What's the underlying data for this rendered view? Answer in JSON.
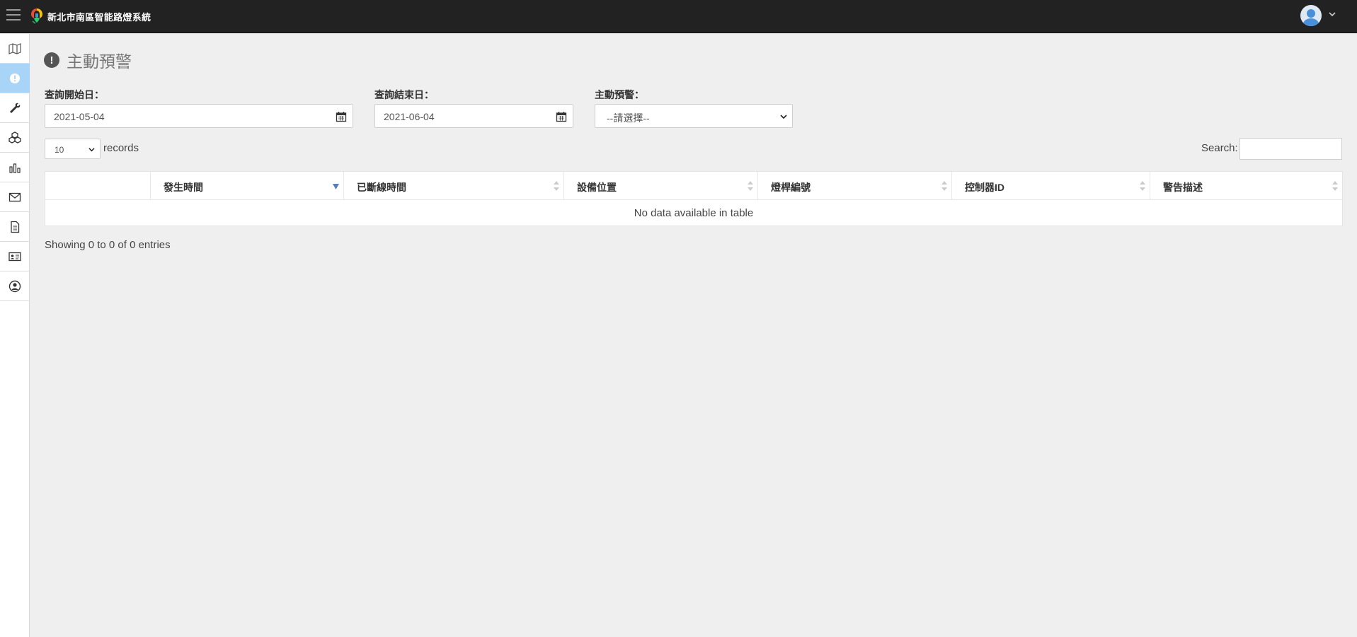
{
  "header": {
    "brand": "新北市南區智能路燈系統",
    "menu_icon": "hamburger-icon",
    "user_icon": "user-avatar-icon"
  },
  "sidebar": {
    "items": [
      {
        "icon": "map-icon",
        "active": false
      },
      {
        "icon": "alert-icon",
        "active": true
      },
      {
        "icon": "wrench-icon",
        "active": false
      },
      {
        "icon": "cubes-icon",
        "active": false
      },
      {
        "icon": "bar-chart-icon",
        "active": false
      },
      {
        "icon": "envelope-icon",
        "active": false
      },
      {
        "icon": "document-icon",
        "active": false
      },
      {
        "icon": "id-card-icon",
        "active": false
      },
      {
        "icon": "user-circle-icon",
        "active": false
      }
    ]
  },
  "page": {
    "title": "主動預警"
  },
  "filters": {
    "start_label": "查詢開始日：",
    "start_value": "2021-05-04",
    "end_label": "查詢結束日：",
    "end_value": "2021-06-04",
    "alert_label": "主動預警：",
    "alert_value": "--請選擇--"
  },
  "table_controls": {
    "length_value": "10",
    "length_label": "records",
    "search_label": "Search:"
  },
  "table": {
    "columns": [
      "",
      "發生時間",
      "已斷線時間",
      "設備位置",
      "燈桿編號",
      "控制器ID",
      "警告描述"
    ],
    "empty_message": "No data available in table"
  },
  "footer_info": "Showing 0 to 0 of 0 entries",
  "colors": {
    "topbar": "#222222",
    "active_sidebar": "#a8d4f7",
    "background": "#efefef"
  }
}
